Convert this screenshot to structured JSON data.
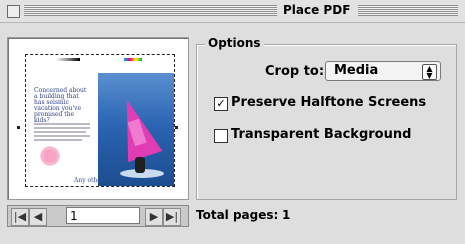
{
  "window": {
    "title": "Place PDF"
  },
  "preview": {
    "headline": "Concerned about a building that has seismic vacation you've promised the kids?",
    "footer": "Any other"
  },
  "navigation": {
    "page_number": "1"
  },
  "options": {
    "group_title": "Options",
    "crop_label": "Crop to:",
    "crop_value": "Media",
    "preserve_halftone_label": "Preserve Halftone Screens",
    "preserve_halftone_checked": true,
    "transparent_bg_label": "Transparent Background",
    "transparent_bg_checked": false
  },
  "footer": {
    "total_pages_label": "Total pages:",
    "total_pages_value": "1"
  },
  "icons": [
    "close-box-icon",
    "first-page-icon",
    "prev-page-icon",
    "next-page-icon",
    "last-page-icon",
    "updown-arrows-icon",
    "checkmark-icon"
  ]
}
